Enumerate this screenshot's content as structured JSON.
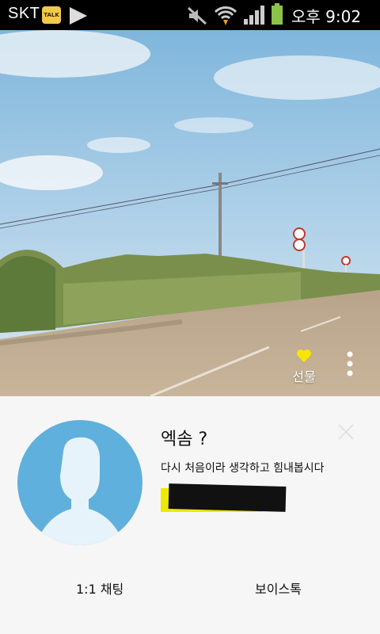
{
  "status_bar": {
    "carrier": "SKT",
    "talk_badge": "TALK",
    "time": "오후 9:02",
    "icons": [
      "kakaotalk-icon",
      "play-icon",
      "mute-icon",
      "wifi-icon",
      "signal-icon",
      "battery-icon"
    ]
  },
  "cover": {
    "gift_label": "선물",
    "gift_icon": "heart-icon",
    "menu_icon": "more-vertical-icon"
  },
  "profile": {
    "name": "엑솜 ?",
    "status_message": "다시 처음이라 생각하고 힘내봅시다",
    "avatar_color": "#5fb0dc",
    "close_icon": "close-icon"
  },
  "actions": {
    "chat_label": "1:1 채팅",
    "voice_label": "보이스톡"
  },
  "colors": {
    "status_bar_bg": "#000000",
    "battery": "#8bc34a",
    "heart": "#f7e600",
    "panel_bg": "#f6f6f6"
  }
}
